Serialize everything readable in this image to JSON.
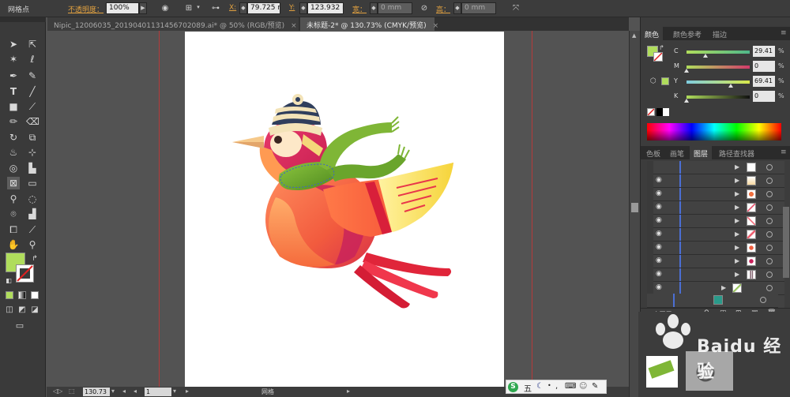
{
  "control_bar": {
    "tool_label": "网格点",
    "opacity_label": "不透明度：",
    "opacity_value": "100%",
    "x_label": "X:",
    "x_value": "79.725 mm",
    "y_label": "Y:",
    "y_value": "123.932 m",
    "w_label": "宽：",
    "w_value": "0 mm",
    "h_label": "高：",
    "h_value": "0 mm"
  },
  "tabs": [
    {
      "label": "Nipic_12006035_20190401131456702089.ai* @ 50% (RGB/预览)",
      "active": false
    },
    {
      "label": "未标题-2* @ 130.73% (CMYK/预览)",
      "active": true
    }
  ],
  "tab_close": "×",
  "status_bar": {
    "zoom": "130.73",
    "artboard": "1",
    "tool_name": "网格"
  },
  "color_panel": {
    "tabs": [
      "颜色",
      "颜色参考",
      "描边"
    ],
    "fill_color": "#b0dd5c",
    "channels": [
      {
        "name": "C",
        "value": "29.41",
        "unit": "%",
        "level": 0.294
      },
      {
        "name": "M",
        "value": "0",
        "unit": "%",
        "level": 0
      },
      {
        "name": "Y",
        "value": "69.41",
        "unit": "%",
        "level": 0.694
      },
      {
        "name": "K",
        "value": "0",
        "unit": "%",
        "level": 0
      }
    ]
  },
  "layers_panel": {
    "tabs": [
      "色板",
      "画笔",
      "图层",
      "路径查找器"
    ],
    "footer": "1 个图层"
  },
  "ime_bar": {
    "mode": "五",
    "icons": [
      "moon-icon",
      "dot-icon",
      "punctuation-icon",
      "keyboard-icon",
      "user-icon",
      "wrench-icon"
    ]
  },
  "watermark": {
    "text": "Baidu 经验"
  },
  "fill_swatch_color": "#b0dd5c"
}
